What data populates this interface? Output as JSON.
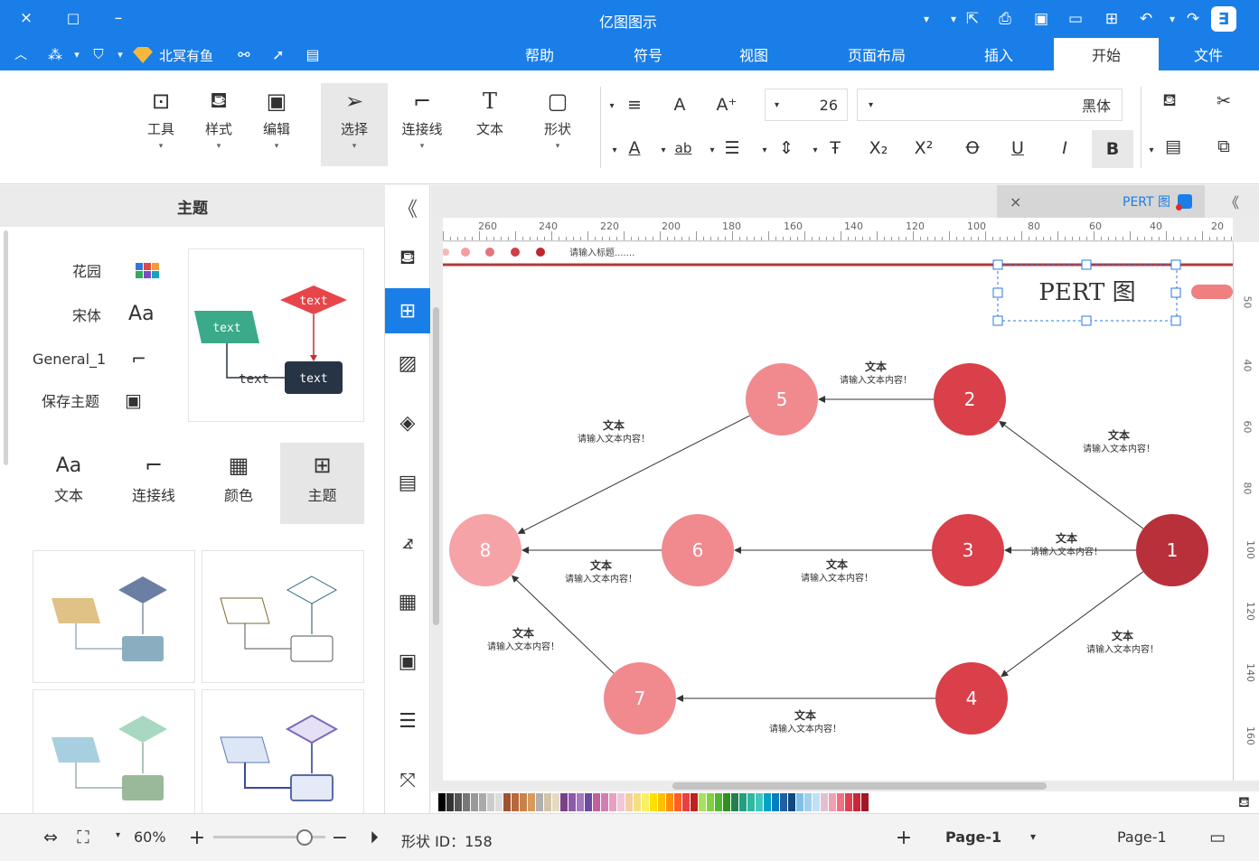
{
  "app": {
    "title": "亿图图示"
  },
  "window": {
    "close": "×",
    "restore": "□",
    "minimize": "–"
  },
  "menu": {
    "tabs": [
      {
        "label": "文件"
      },
      {
        "label": "开始"
      },
      {
        "label": "插入"
      },
      {
        "label": "页面布局"
      },
      {
        "label": "视图"
      },
      {
        "label": "符号"
      },
      {
        "label": "帮助"
      }
    ],
    "active": "开始",
    "user": "北冥有鱼"
  },
  "ribbon": {
    "font_name": "黑体",
    "font_size": "26",
    "tools": [
      {
        "label": "形状"
      },
      {
        "label": "文本"
      },
      {
        "label": "连接线"
      },
      {
        "label": "选择"
      },
      {
        "label": "编辑"
      },
      {
        "label": "样式"
      },
      {
        "label": "工具"
      }
    ]
  },
  "leftpanel": {
    "title": "主题",
    "theme_rows": [
      {
        "label": "花园"
      },
      {
        "label": "宋体"
      },
      {
        "label": "General_1"
      },
      {
        "label": "保存主题"
      }
    ],
    "preview_labels": [
      "text",
      "text",
      "text",
      "text"
    ],
    "tabs": [
      {
        "label": "文本"
      },
      {
        "label": "连接线"
      },
      {
        "label": "颜色"
      },
      {
        "label": "主题"
      }
    ]
  },
  "doc": {
    "tab_title": "PERT 图",
    "tab_close": "×"
  },
  "ruler": {
    "top": [
      "20",
      "40",
      "60",
      "80",
      "100",
      "120",
      "140",
      "160",
      "180",
      "200",
      "220",
      "240",
      "260"
    ],
    "right": [
      "50",
      "40",
      "60",
      "80",
      "100",
      "120",
      "140",
      "160"
    ]
  },
  "diagram": {
    "title": "PERT 图",
    "header_hint": "请输入标题.......",
    "nodes": [
      {
        "label": "1"
      },
      {
        "label": "2"
      },
      {
        "label": "3"
      },
      {
        "label": "4"
      },
      {
        "label": "5"
      },
      {
        "label": "6"
      },
      {
        "label": "7"
      },
      {
        "label": "8"
      }
    ],
    "edge_title": "文本",
    "edge_sub": "请输入文本内容！"
  },
  "status": {
    "page_select": "Page-1",
    "page_tab": "Page-1",
    "add": "+",
    "shape_id": "形状 ID：158",
    "zoom": "60%"
  },
  "colors": {
    "accent": "#1a7ee8",
    "node_dark": "#b8303a",
    "node_mid": "#d9404a",
    "node_light": "#f08a8f",
    "node_pale": "#f5a3a6"
  }
}
